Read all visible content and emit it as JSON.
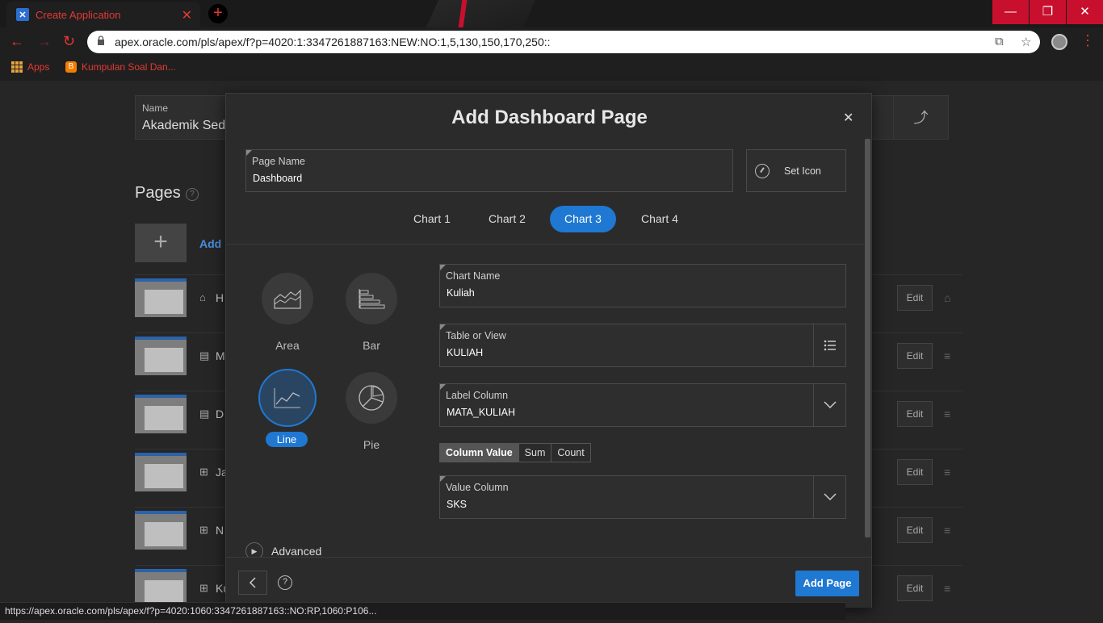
{
  "browser": {
    "tab_title": "Create Application",
    "url": "apex.oracle.com/pls/apex/f?p=4020:1:3347261887163:NEW:NO:1,5,130,150,170,250::",
    "bookmarks": [
      {
        "label": "Apps"
      },
      {
        "label": "Kumpulan Soal Dan..."
      }
    ],
    "status_url": "https://apex.oracle.com/pls/apex/f?p=4020:1060:3347261887163::NO:RP,1060:P106..."
  },
  "background": {
    "name_label": "Name",
    "name_value": "Akademik Seder",
    "pages_title": "Pages",
    "add_label": "Add",
    "rows": [
      {
        "text": "H",
        "icon": "home-icon"
      },
      {
        "text": "M",
        "icon": "form-icon"
      },
      {
        "text": "D",
        "icon": "form-icon"
      },
      {
        "text": "Ja",
        "icon": "grid-icon"
      },
      {
        "text": "N",
        "icon": "grid-icon"
      },
      {
        "text": "Ku",
        "icon": "grid-icon"
      }
    ],
    "edit_label": "Edit"
  },
  "dialog": {
    "title": "Add Dashboard Page",
    "page_name_label": "Page Name",
    "page_name_value": "Dashboard",
    "set_icon_label": "Set Icon",
    "tabs": [
      "Chart 1",
      "Chart 2",
      "Chart 3",
      "Chart 4"
    ],
    "active_tab": "Chart 3",
    "chart_types": [
      "Area",
      "Bar",
      "Line",
      "Pie"
    ],
    "selected_chart_type": "Line",
    "chart_name_label": "Chart Name",
    "chart_name_value": "Kuliah",
    "table_label": "Table or View",
    "table_value": "KULIAH",
    "label_column_label": "Label Column",
    "label_column_value": "MATA_KULIAH",
    "aggregation_options": [
      "Column Value",
      "Sum",
      "Count"
    ],
    "selected_aggregation": "Column Value",
    "value_column_label": "Value Column",
    "value_column_value": "SKS",
    "advanced_label": "Advanced",
    "add_page_label": "Add Page"
  },
  "colors": {
    "accent": "#1f78d1",
    "chrome_red": "#c8102e",
    "dialog_bg": "#2b2b2b"
  }
}
